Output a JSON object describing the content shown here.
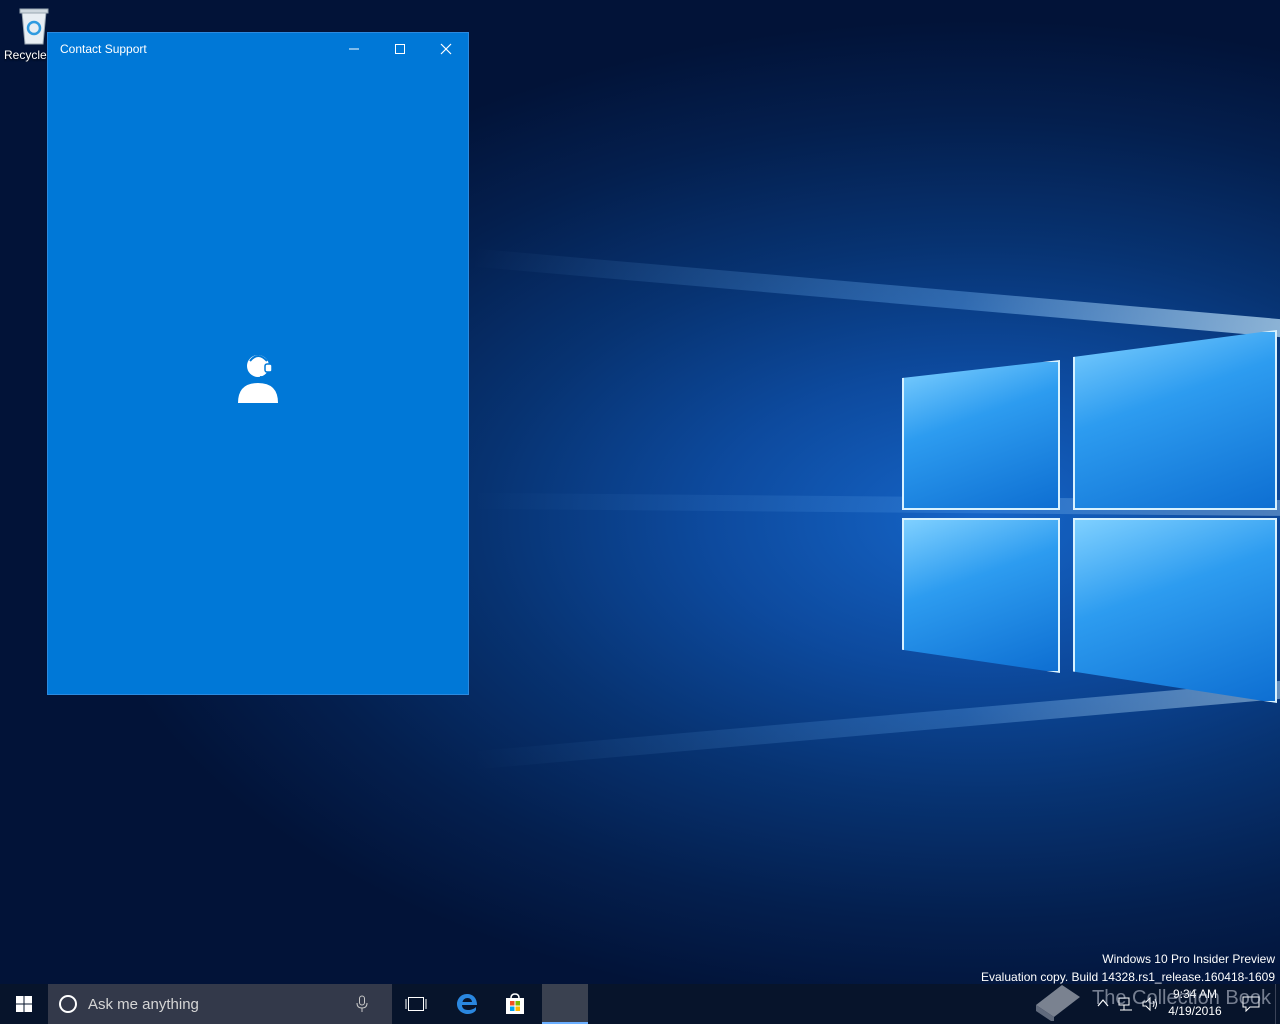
{
  "desktop": {
    "recycle_bin_label": "Recycle Bin"
  },
  "window": {
    "title": "Contact Support",
    "splash_icon": "support-agent-headset-icon",
    "background_color": "#0078d7"
  },
  "watermark": {
    "line1": "Windows 10 Pro Insider Preview",
    "line2": "Evaluation copy. Build 14328.rs1_release.160418-1609"
  },
  "taskbar": {
    "search_placeholder": "Ask me anything",
    "pinned": [
      "task-view-icon",
      "edge-icon",
      "store-icon",
      "contact-support-app-icon"
    ],
    "tray_icons": [
      "chevron-up-icon",
      "network-icon",
      "volume-icon",
      "action-center-icon"
    ],
    "clock_time": "9:34 AM",
    "clock_date": "4/19/2016",
    "overlay_text": "The Collection Book"
  }
}
